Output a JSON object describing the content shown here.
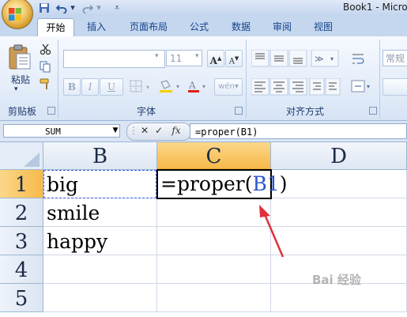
{
  "window": {
    "title": "Book1 - Micro"
  },
  "quick_access": {
    "save_icon": "save-icon",
    "undo_icon": "undo-icon",
    "redo_icon": "redo-icon",
    "customize_icon": "chevron-down-icon"
  },
  "tabs": [
    {
      "label": "开始",
      "active": true
    },
    {
      "label": "插入"
    },
    {
      "label": "页面布局"
    },
    {
      "label": "公式"
    },
    {
      "label": "数据"
    },
    {
      "label": "审阅"
    },
    {
      "label": "视图"
    }
  ],
  "ribbon": {
    "clipboard": {
      "label": "剪贴板",
      "paste": "粘贴"
    },
    "font": {
      "label": "字体",
      "size": "11",
      "bold": "B",
      "italic": "I",
      "underline": "U",
      "phonetic": "wén",
      "grow": "A",
      "shrink": "A"
    },
    "alignment": {
      "label": "对齐方式"
    },
    "number": {
      "format": "常规"
    }
  },
  "formula_bar": {
    "name_box": "SUM",
    "cancel": "✕",
    "enter": "✓",
    "fx": "fx",
    "content": "=proper(B1)"
  },
  "grid": {
    "columns": [
      "B",
      "C",
      "D"
    ],
    "rows": [
      "1",
      "2",
      "3",
      "4",
      "5"
    ],
    "cells": {
      "B1": "big",
      "B2": "smile",
      "B3": "happy",
      "C1_prefix": "=proper(",
      "C1_ref": "B1",
      "C1_suffix": ")"
    }
  },
  "watermark": "Bai 经验",
  "colors": {
    "accent": "#f7b94a",
    "reference": "#2c55c6",
    "arrow": "#e0313b"
  }
}
